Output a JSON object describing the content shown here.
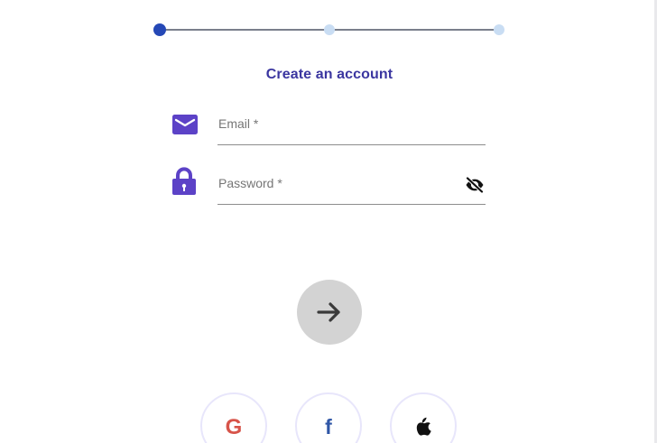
{
  "stepper": {
    "steps": 3,
    "active_step": 1
  },
  "form": {
    "heading": "Create an account",
    "email": {
      "label": "Email *",
      "value": "",
      "icon": "mail-icon"
    },
    "password": {
      "label": "Password *",
      "value": "",
      "icon": "lock-icon",
      "toggle_icon": "visibility-off-icon"
    },
    "next_icon": "arrow-right-icon"
  },
  "social": {
    "google": {
      "glyph": "G",
      "icon": "google-icon"
    },
    "facebook": {
      "glyph": "f",
      "icon": "facebook-icon"
    },
    "apple": {
      "icon": "apple-icon"
    }
  },
  "colors": {
    "accent": "#3b36a0",
    "step_active": "#2548b6",
    "step_inactive": "#c9ddf3",
    "icon_purple": "#5c42c7",
    "next_button_bg": "#d3d3d3",
    "google": "#d7544a",
    "facebook": "#2f56a6"
  }
}
